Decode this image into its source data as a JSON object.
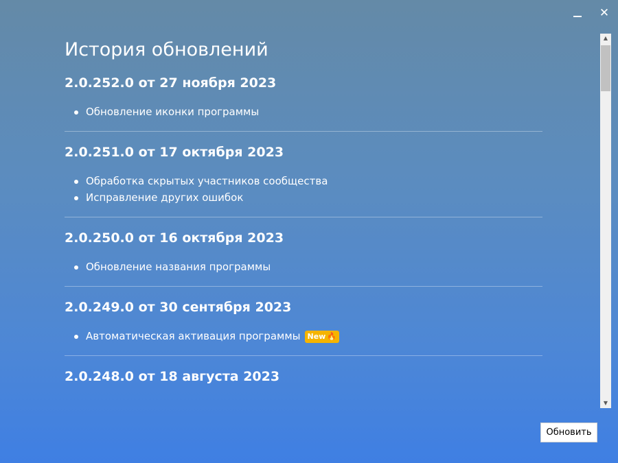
{
  "window": {
    "minimize_icon": "minimize-icon",
    "close_icon": "close-icon",
    "close_glyph": "✕"
  },
  "page": {
    "title": "История обновлений"
  },
  "releases": [
    {
      "version": "2.0.252.0 от 27 ноября 2023",
      "items": [
        "Обновление иконки программы"
      ]
    },
    {
      "version": "2.0.251.0 от 17 октября 2023",
      "items": [
        "Обработка скрытых участников сообщества",
        "Исправление других ошибок"
      ]
    },
    {
      "version": "2.0.250.0 от 16 октября 2023",
      "items": [
        "Обновление названия программы"
      ]
    },
    {
      "version": "2.0.249.0 от 30 сентября 2023",
      "items": [
        "Автоматическая активация программы"
      ],
      "badge": "New",
      "badge_icon": "flame-icon",
      "badge_color": "#f5b400"
    },
    {
      "version": "2.0.248.0 от 18 августа 2023",
      "items": []
    }
  ],
  "scrollbar": {
    "up_glyph": "▲",
    "down_glyph": "▼"
  },
  "footer": {
    "update_button": "Обновить"
  },
  "colors": {
    "background_top": "#648aa7",
    "background_bottom": "#3f7fe3",
    "accent_badge": "#f5b400"
  }
}
